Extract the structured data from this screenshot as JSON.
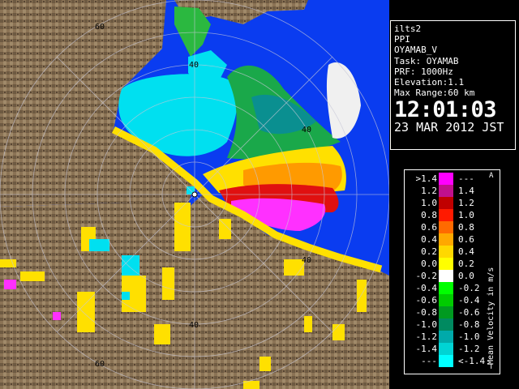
{
  "radar": {
    "ring_labels": [
      "60",
      "40",
      "40",
      "40",
      "40",
      "60"
    ],
    "colors": {
      "sea": "#0a3cf0",
      "land": "#8b7355",
      "approach": "#00e8f0",
      "recede_yellow": "#ffe000",
      "recede_orange": "#ff9a00",
      "recede_red": "#e01010",
      "recede_magenta": "#ff30ff",
      "approach_green": "#20c020",
      "near_zero": "#e8e8e8"
    }
  },
  "info": {
    "station": "ilts2",
    "mode": "PPI",
    "product": "OYAMAB_V",
    "task": "Task: OYAMAB",
    "prf": "PRF: 1000Hz",
    "elevation": "Elevation:1.1",
    "max_range": "Max Range:60 km",
    "time": "12:01:03",
    "date": "23 MAR 2012 JST"
  },
  "legend": {
    "title": "Mean Velocity in m/s",
    "top_mark": "A",
    "bottom_mark": "T",
    "rows": [
      {
        "left": ">1.4",
        "right": "---",
        "color": "#ff00ff"
      },
      {
        "left": "1.2",
        "right": "1.4",
        "color": "#c0108c"
      },
      {
        "left": "1.0",
        "right": "1.2",
        "color": "#c00000"
      },
      {
        "left": "0.8",
        "right": "1.0",
        "color": "#ff1a00"
      },
      {
        "left": "0.6",
        "right": "0.8",
        "color": "#ff6a00"
      },
      {
        "left": "0.4",
        "right": "0.6",
        "color": "#ffa800"
      },
      {
        "left": "0.2",
        "right": "0.4",
        "color": "#ffd800"
      },
      {
        "left": "0.0",
        "right": "0.2",
        "color": "#ffff00"
      },
      {
        "left": "-0.2",
        "right": "0.0",
        "color": "#ffffff"
      },
      {
        "left": "-0.4",
        "right": "-0.2",
        "color": "#00ff00"
      },
      {
        "left": "-0.6",
        "right": "-0.4",
        "color": "#00cc00"
      },
      {
        "left": "-0.8",
        "right": "-0.6",
        "color": "#009a20"
      },
      {
        "left": "-1.0",
        "right": "-0.8",
        "color": "#008a60"
      },
      {
        "left": "-1.2",
        "right": "-1.0",
        "color": "#00aaaa"
      },
      {
        "left": "-1.4",
        "right": "-1.2",
        "color": "#00d4d4"
      },
      {
        "left": "---",
        "right": "<-1.4",
        "color": "#00ffff"
      }
    ]
  }
}
